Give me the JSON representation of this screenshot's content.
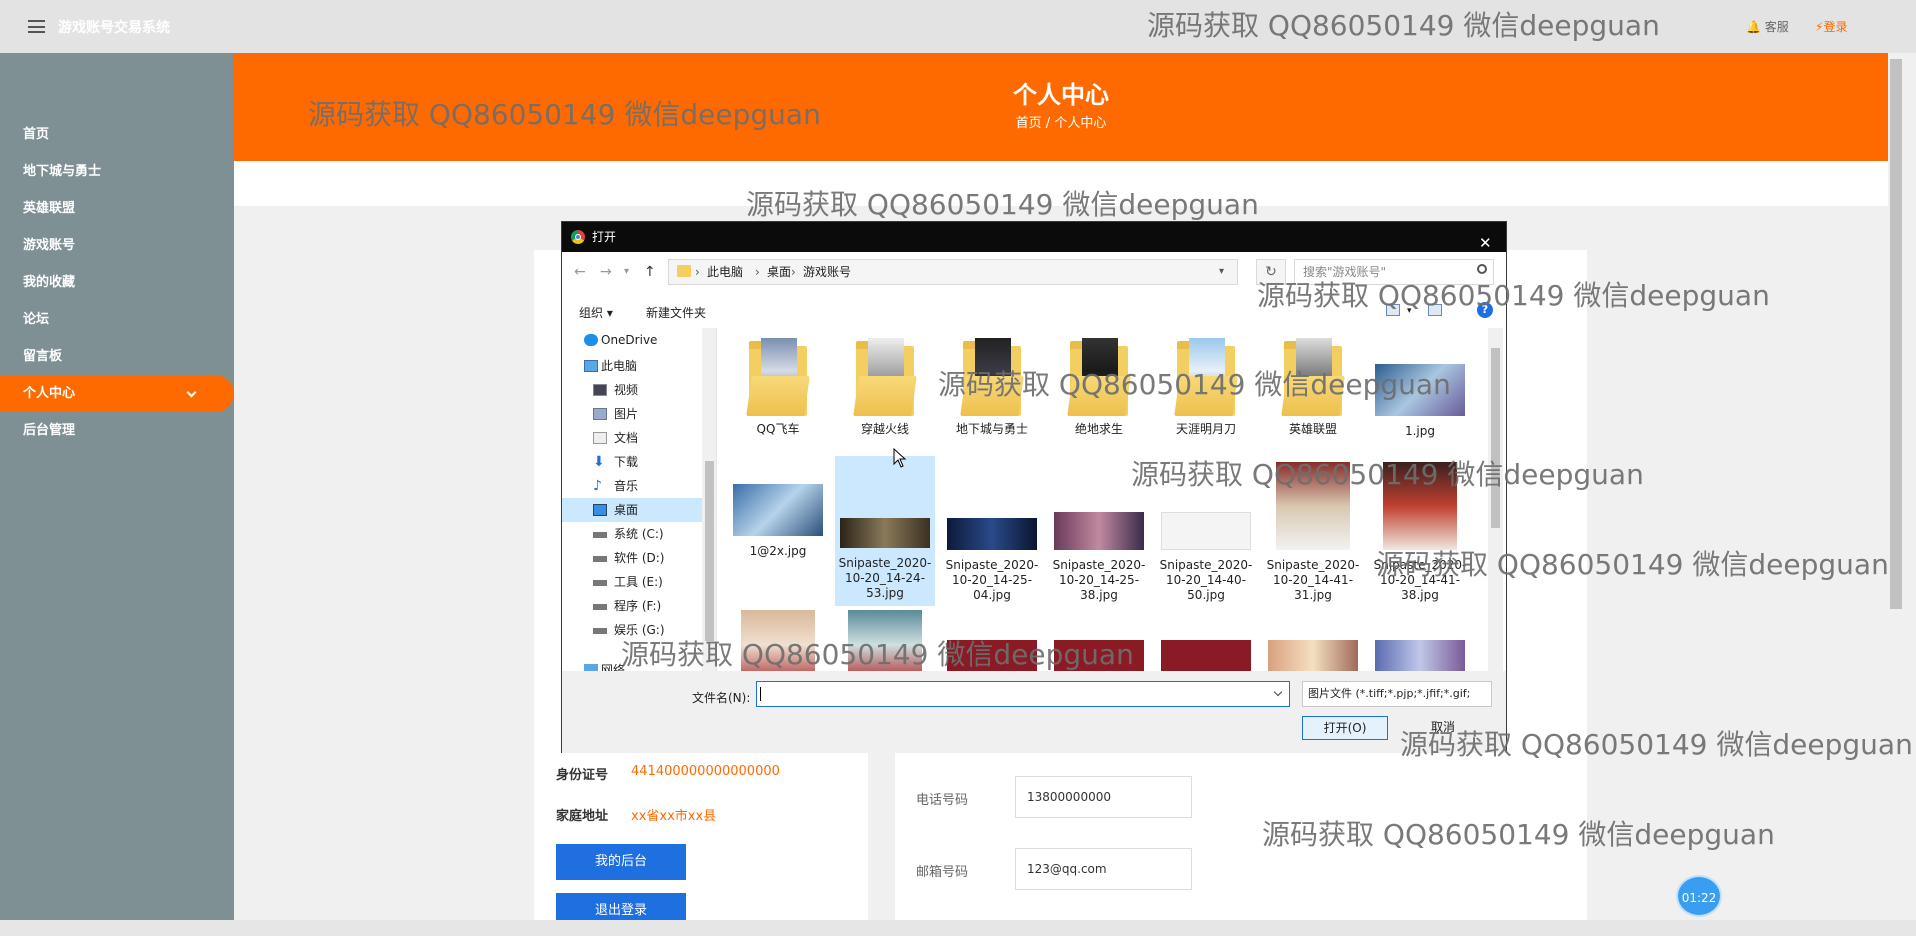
{
  "app": {
    "title": "游戏账号交易系统",
    "service": "客服",
    "login": "登录"
  },
  "sidebar": {
    "items": [
      {
        "label": "首页"
      },
      {
        "label": "地下城与勇士"
      },
      {
        "label": "英雄联盟"
      },
      {
        "label": "游戏账号"
      },
      {
        "label": "我的收藏"
      },
      {
        "label": "论坛"
      },
      {
        "label": "留言板"
      },
      {
        "label": "个人中心"
      },
      {
        "label": "后台管理"
      }
    ],
    "active": "个人中心"
  },
  "banner": {
    "title": "个人中心",
    "breadcrumb": "首页 / 个人中心"
  },
  "profile": {
    "id_label": "身份证号",
    "id_value": "441400000000000000",
    "addr_label": "家庭地址",
    "addr_value": "xx省xx市xx县",
    "btn_backend": "我的后台",
    "btn_logout": "退出登录",
    "phone_label": "电话号码",
    "phone_value": "13800000000",
    "email_label": "邮箱号码",
    "email_value": "123@qq.com"
  },
  "watermark": "源码获取 QQ86050149 微信deepguan",
  "timer": "01:22",
  "dialog": {
    "title": "打开",
    "path": [
      "此电脑",
      "桌面",
      "游戏账号"
    ],
    "search_placeholder": "搜索\"游戏账号\"",
    "organize": "组织 ▾",
    "new_folder": "新建文件夹",
    "help": "?",
    "nav_tree": [
      {
        "label": "OneDrive",
        "icon": "cloud-icon"
      },
      {
        "label": "此电脑",
        "icon": "computer-icon"
      },
      {
        "label": "视频",
        "icon": "video-icon"
      },
      {
        "label": "图片",
        "icon": "picture-icon"
      },
      {
        "label": "文档",
        "icon": "document-icon"
      },
      {
        "label": "下载",
        "icon": "download-icon"
      },
      {
        "label": "音乐",
        "icon": "music-icon"
      },
      {
        "label": "桌面",
        "icon": "desktop-icon"
      },
      {
        "label": "系统 (C:)",
        "icon": "drive-icon"
      },
      {
        "label": "软件 (D:)",
        "icon": "drive-icon"
      },
      {
        "label": "工具 (E:)",
        "icon": "drive-icon"
      },
      {
        "label": "程序 (F:)",
        "icon": "drive-icon"
      },
      {
        "label": "娱乐 (G:)",
        "icon": "drive-icon"
      },
      {
        "label": "网络",
        "icon": "network-icon"
      }
    ],
    "selected_nav": "桌面",
    "files": [
      {
        "name": "QQ飞车",
        "kind": "folder"
      },
      {
        "name": "穿越火线",
        "kind": "folder"
      },
      {
        "name": "地下城与勇士",
        "kind": "folder"
      },
      {
        "name": "绝地求生",
        "kind": "folder"
      },
      {
        "name": "天涯明月刀",
        "kind": "folder"
      },
      {
        "name": "英雄联盟",
        "kind": "folder"
      },
      {
        "name": "1.jpg",
        "kind": "image"
      },
      {
        "name": "1@2x.jpg",
        "kind": "image"
      },
      {
        "name": "Snipaste_2020-10-20_14-24-53.jpg",
        "kind": "image"
      },
      {
        "name": "Snipaste_2020-10-20_14-25-04.jpg",
        "kind": "image"
      },
      {
        "name": "Snipaste_2020-10-20_14-25-38.jpg",
        "kind": "image"
      },
      {
        "name": "Snipaste_2020-10-20_14-40-50.jpg",
        "kind": "image"
      },
      {
        "name": "Snipaste_2020-10-20_14-41-31.jpg",
        "kind": "image"
      },
      {
        "name": "Snipaste_2020-10-20_14-41-38.jpg",
        "kind": "image"
      }
    ],
    "selected_file": "Snipaste_2020-10-20_14-24-53.jpg",
    "filename_label": "文件名(N):",
    "filename_value": "",
    "filetype": "图片文件 (*.tiff;*.pjp;*.jfif;*.gif;",
    "open": "打开(O)",
    "cancel": "取消"
  },
  "colors": {
    "accent": "#ff6a00",
    "sidebar": "#7f9095",
    "button": "#1e6fe0",
    "selection": "#cce8ff"
  }
}
